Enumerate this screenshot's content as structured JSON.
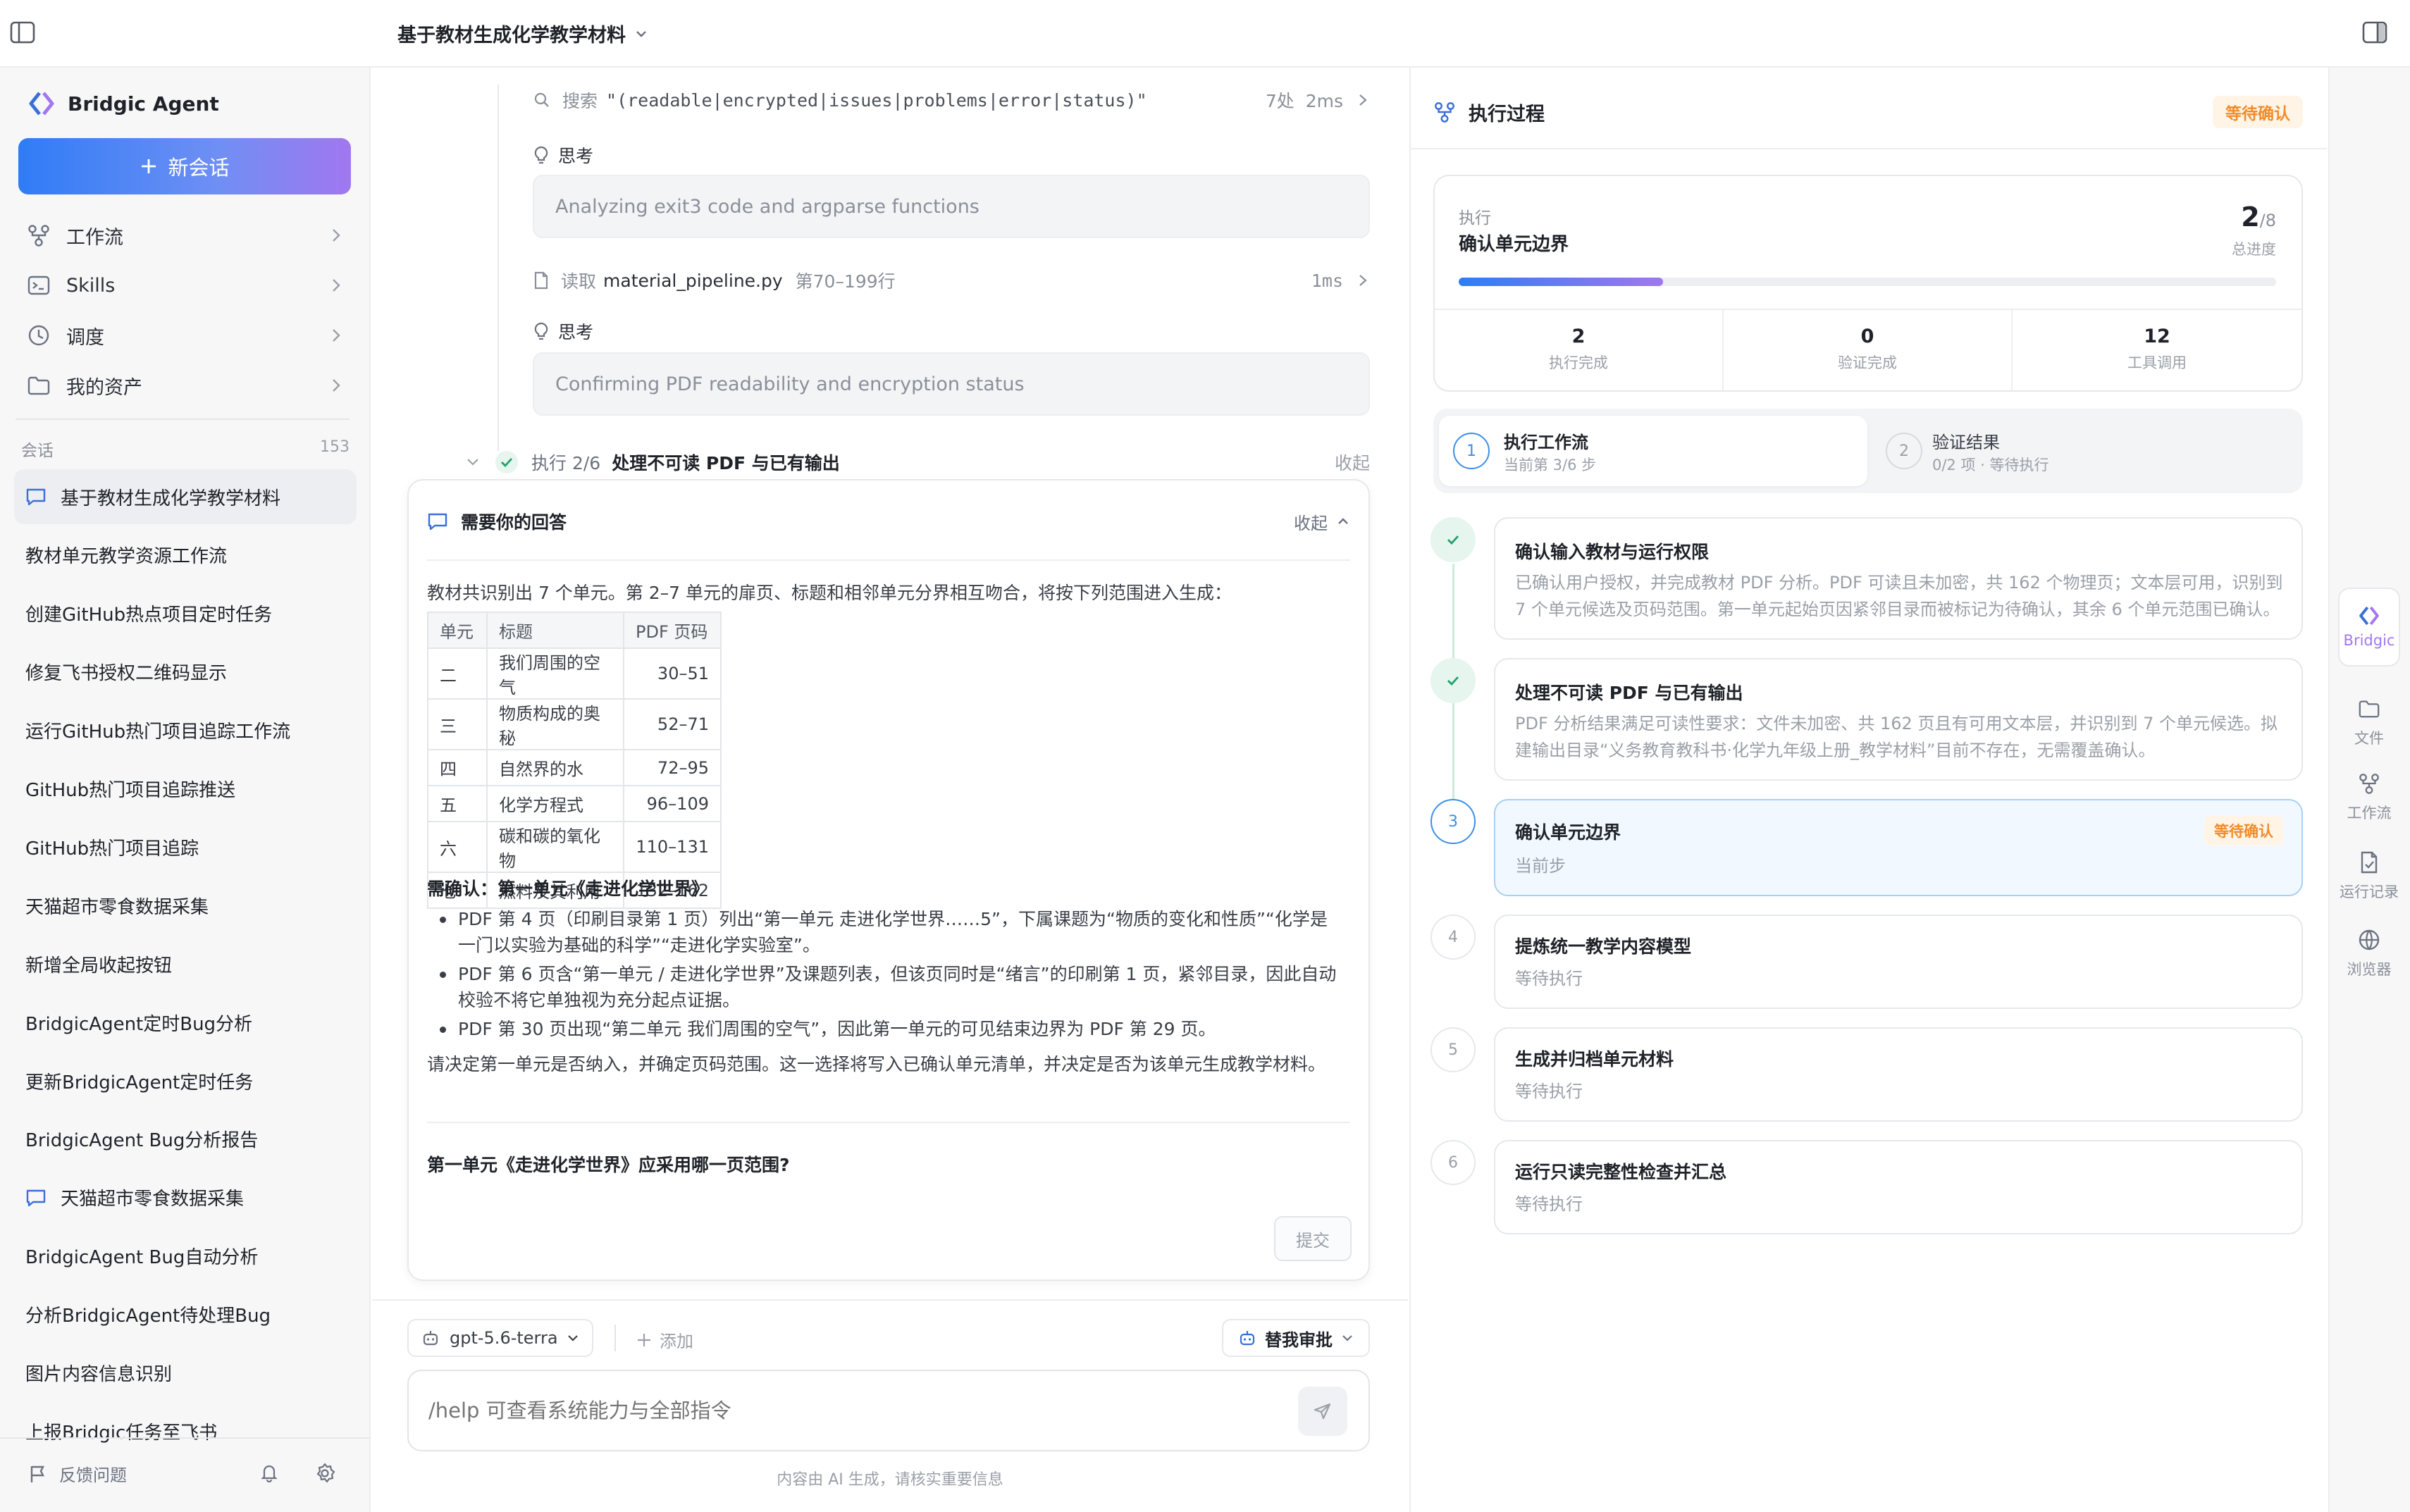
{
  "topbar": {
    "title": "基于教材生成化学教学材料"
  },
  "sidebar": {
    "brand": "Bridgic Agent",
    "new_chat": "新会话",
    "nav": [
      {
        "label": "工作流",
        "icon": "workflow-icon"
      },
      {
        "label": "Skills",
        "icon": "terminal-icon"
      },
      {
        "label": "调度",
        "icon": "clock-icon"
      },
      {
        "label": "我的资产",
        "icon": "folder-icon"
      }
    ],
    "section_label": "会话",
    "section_count": "153",
    "conversations": [
      "基于教材生成化学教学材料",
      "教材单元教学资源工作流",
      "创建GitHub热点项目定时任务",
      "修复飞书授权二维码显示",
      "运行GitHub热门项目追踪工作流",
      "GitHub热门项目追踪推送",
      "GitHub热门项目追踪",
      "天猫超市零食数据采集",
      "新增全局收起按钮",
      "BridgicAgent定时Bug分析",
      "更新BridgicAgent定时任务",
      "BridgicAgent Bug分析报告",
      "天猫超市零食数据采集",
      "BridgicAgent Bug自动分析",
      "分析BridgicAgent待处理Bug",
      "图片内容信息识别",
      "上报Bridgic任务至飞书"
    ],
    "feedback": "反馈问题"
  },
  "chat": {
    "search_label": "搜索",
    "search_query": "\"(readable|encrypted|issues|problems|error|status)\"",
    "search_meta": "7处  2ms",
    "think_label": "思考",
    "think1": "Analyzing exit3 code and argparse functions",
    "read_label": "读取",
    "read_file": "material_pipeline.py",
    "read_range": "第70–199行",
    "read_time": "1ms",
    "think2": "Confirming PDF readability and encryption status",
    "exec_label": "执行 2/6",
    "exec_title": "处理不可读 PDF 与已有输出",
    "collapse": "收起",
    "card": {
      "title": "需要你的回答",
      "collapse": "收起",
      "intro": "教材共识别出 7 个单元。第 2–7 单元的扉页、标题和相邻单元分界相互吻合，将按下列范围进入生成：",
      "table_headers": [
        "单元",
        "标题",
        "PDF 页码"
      ],
      "table_rows": [
        [
          "二",
          "我们周围的空气",
          "30–51"
        ],
        [
          "三",
          "物质构成的奥秘",
          "52–71"
        ],
        [
          "四",
          "自然界的水",
          "72–95"
        ],
        [
          "五",
          "化学方程式",
          "96–109"
        ],
        [
          "六",
          "碳和碳的氧化物",
          "110–131"
        ],
        [
          "七",
          "燃料及其利用",
          "132–162"
        ]
      ],
      "confirm_title": "需确认：第一单元《走进化学世界》",
      "bullets": [
        "PDF 第 4 页（印刷目录第 1 页）列出“第一单元 走进化学世界……5”，下属课题为“物质的变化和性质”“化学是一门以实验为基础的科学”“走进化学实验室”。",
        "PDF 第 6 页含“第一单元 / 走进化学世界”及课题列表，但该页同时是“绪言”的印刷第 1 页，紧邻目录，因此自动校验不将它单独视为充分起点证据。",
        "PDF 第 30 页出现“第二单元 我们周围的空气”，因此第一单元的可见结束边界为 PDF 第 29 页。"
      ],
      "closing": "请决定第一单元是否纳入，并确定页码范围。这一选择将写入已确认单元清单，并决定是否为该单元生成教学材料。",
      "question": "第一单元《走进化学世界》应采用哪一页范围?",
      "submit": "提交"
    },
    "model": "gpt-5.6-terra",
    "add": "添加",
    "approve": "替我审批",
    "input_placeholder": "/help 可查看系统能力与全部指令",
    "disclaimer": "内容由 AI 生成，请核实重要信息"
  },
  "panel": {
    "title": "执行过程",
    "status": "等待确认",
    "exec_label": "执行",
    "current_step": "确认单元边界",
    "progress_current": "2",
    "progress_total": "/8",
    "progress_label": "总进度",
    "progress_fraction": 0.25,
    "stats": [
      {
        "value": "2",
        "label": "执行完成"
      },
      {
        "value": "0",
        "label": "验证完成"
      },
      {
        "value": "12",
        "label": "工具调用"
      }
    ],
    "phase1_title": "执行工作流",
    "phase1_sub": "当前第 3/6 步",
    "phase2_num": "2",
    "phase2_title": "验证结果",
    "phase2_sub": "0/2 项 · 等待执行",
    "phase1_num": "1",
    "steps": [
      {
        "num": "1",
        "title": "确认输入教材与运行权限",
        "desc": "已确认用户授权，并完成教材 PDF 分析。PDF 可读且未加密，共 162 个物理页；文本层可用，识别到 7 个单元候选及页码范围。第一单元起始页因紧邻目录而被标记为待确认，其余 6 个单元范围已确认。"
      },
      {
        "num": "2",
        "title": "处理不可读 PDF 与已有输出",
        "desc": "PDF 分析结果满足可读性要求：文件未加密、共 162 页且有可用文本层，并识别到 7 个单元候选。拟建输出目录“义务教育教科书·化学九年级上册_教学材料”目前不存在，无需覆盖确认。"
      },
      {
        "num": "3",
        "title": "确认单元边界",
        "desc": "当前步",
        "badge": "等待确认"
      },
      {
        "num": "4",
        "title": "提炼统一教学内容模型",
        "desc": "等待执行"
      },
      {
        "num": "5",
        "title": "生成并归档单元材料",
        "desc": "等待执行"
      },
      {
        "num": "6",
        "title": "运行只读完整性检查并汇总",
        "desc": "等待执行"
      }
    ]
  },
  "rail": {
    "items": [
      {
        "label": "Bridgic"
      },
      {
        "label": "文件"
      },
      {
        "label": "工作流"
      },
      {
        "label": "运行记录"
      },
      {
        "label": "浏览器"
      }
    ]
  },
  "colors": {
    "accent": "#3b6fd8",
    "gradient_start": "#2f7cf6",
    "gradient_end": "#a177f0",
    "warn": "#f08c2c",
    "success": "#22a06b"
  }
}
